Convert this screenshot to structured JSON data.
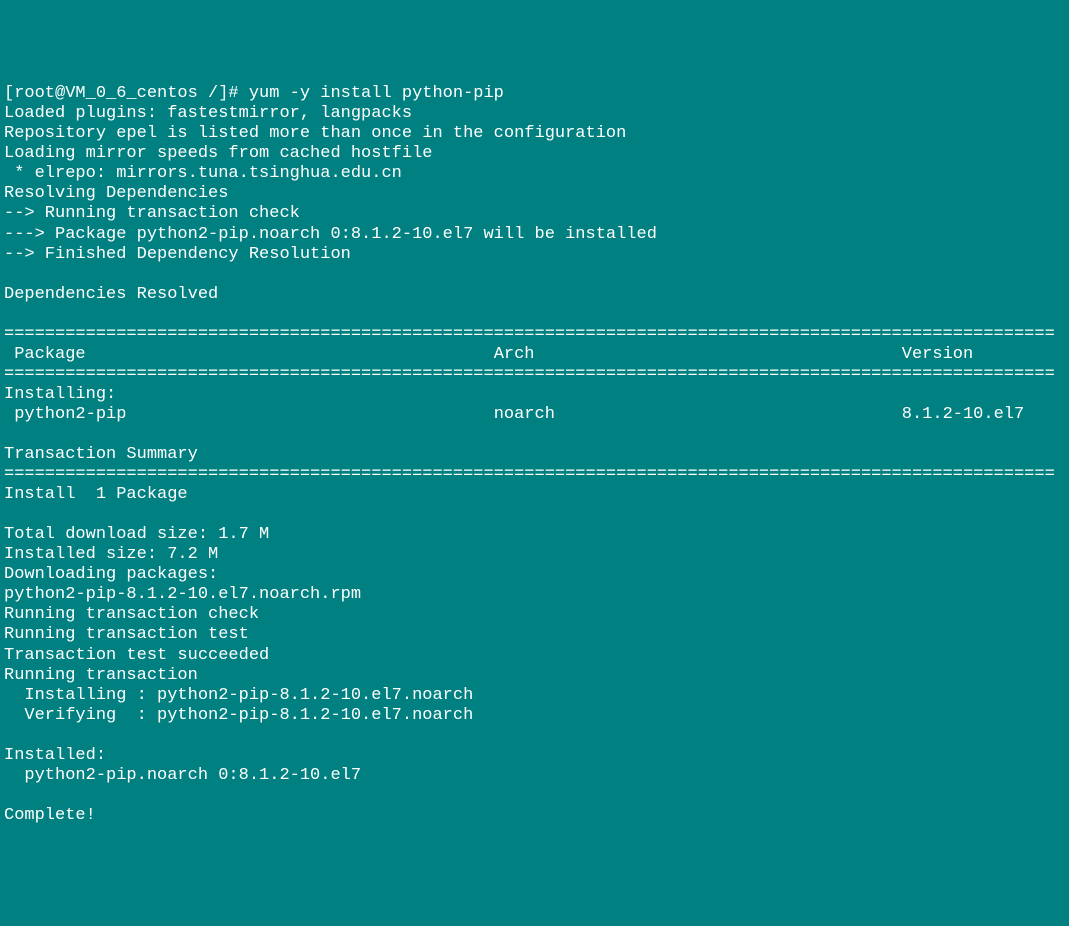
{
  "prompt": {
    "user_host": "[root@VM_0_6_centos /]#",
    "command": "yum -y install python-pip"
  },
  "output_lines": {
    "loaded_plugins": "Loaded plugins: fastestmirror, langpacks",
    "repo_warning": "Repository epel is listed more than once in the configuration",
    "loading_mirrors": "Loading mirror speeds from cached hostfile",
    "elrepo_mirror": " * elrepo: mirrors.tuna.tsinghua.edu.cn",
    "resolving_deps": "Resolving Dependencies",
    "running_trans_check": "--> Running transaction check",
    "package_install": "---> Package python2-pip.noarch 0:8.1.2-10.el7 will be installed",
    "finished_resolution": "--> Finished Dependency Resolution",
    "deps_resolved": "Dependencies Resolved"
  },
  "table_header": {
    "package": " Package",
    "arch": "Arch",
    "version": "Version"
  },
  "table_rows": {
    "installing_label": "Installing:",
    "pkg_name": " python2-pip",
    "pkg_arch": "noarch",
    "pkg_version": "8.1.2-10.el7"
  },
  "transaction": {
    "summary_label": "Transaction Summary",
    "install_count": "Install  1 Package",
    "download_size": "Total download size: 1.7 M",
    "installed_size": "Installed size: 7.2 M",
    "downloading": "Downloading packages:",
    "rpm_file": "python2-pip-8.1.2-10.el7.noarch.rpm",
    "trans_check": "Running transaction check",
    "trans_test": "Running transaction test",
    "trans_succeeded": "Transaction test succeeded",
    "running_trans": "Running transaction",
    "installing_line": "  Installing : python2-pip-8.1.2-10.el7.noarch",
    "verifying_line": "  Verifying  : python2-pip-8.1.2-10.el7.noarch",
    "installed_label": "Installed:",
    "installed_pkg": "  python2-pip.noarch 0:8.1.2-10.el7",
    "complete": "Complete!"
  },
  "divider": "======================================================================================================="
}
